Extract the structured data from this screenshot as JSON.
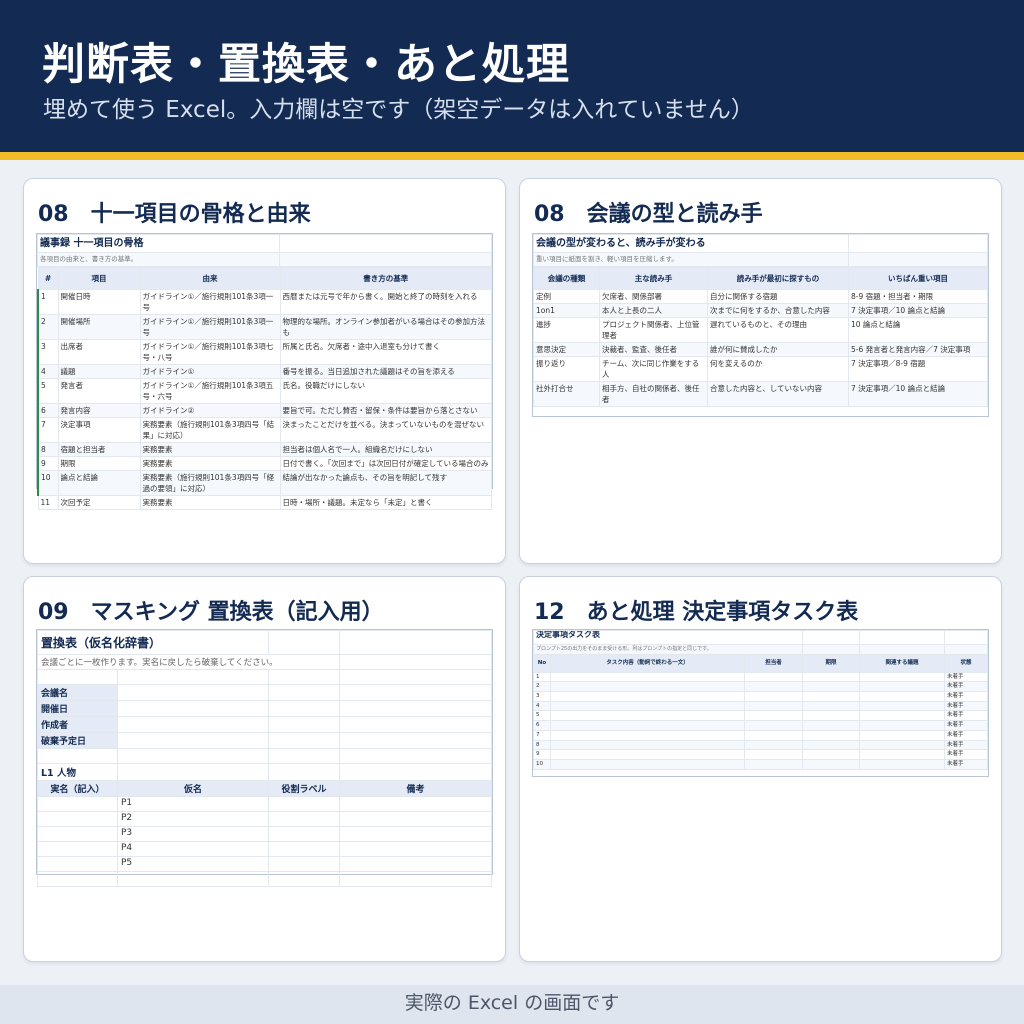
{
  "header": {
    "title": "判断表・置換表・あと処理",
    "subtitle": "埋めて使う Excel。入力欄は空です（架空データは入れていません）"
  },
  "panels": [
    {
      "title": "08　十一項目の骨格と由来",
      "sheet_title": "議事録 十一項目の骨格",
      "sheet_note": "各項目の由来と、書き方の基準。",
      "columns": [
        "#",
        "項目",
        "由来",
        "書き方の基準"
      ],
      "rows": [
        [
          "1",
          "開催日時",
          "ガイドライン①／施行規則101条3項一号",
          "西暦または元号で年から書く。開始と終了の時刻を入れる"
        ],
        [
          "2",
          "開催場所",
          "ガイドライン①／施行規則101条3項一号",
          "物理的な場所。オンライン参加者がいる場合はその参加方法も"
        ],
        [
          "3",
          "出席者",
          "ガイドライン①／施行規則101条3項七号・八号",
          "所属と氏名。欠席者・途中入退室も分けて書く"
        ],
        [
          "4",
          "議題",
          "ガイドライン①",
          "番号を振る。当日追加された議題はその旨を添える"
        ],
        [
          "5",
          "発言者",
          "ガイドライン①／施行規則101条3項五号・六号",
          "氏名。役職だけにしない"
        ],
        [
          "6",
          "発言内容",
          "ガイドライン②",
          "要旨で可。ただし賛否・留保・条件は要旨から落とさない"
        ],
        [
          "7",
          "決定事項",
          "実務要素（施行規則101条3項四号「結果」に対応）",
          "決まったことだけを並べる。決まっていないものを混ぜない"
        ],
        [
          "8",
          "宿題と担当者",
          "実務要素",
          "担当者は個人名で一人。組織名だけにしない"
        ],
        [
          "9",
          "期限",
          "実務要素",
          "日付で書く。「次回まで」は次回日付が確定している場合のみ"
        ],
        [
          "10",
          "論点と結論",
          "実務要素（施行規則101条3項四号「経過の要領」に対応）",
          "結論が出なかった論点も、その旨を明記して残す"
        ],
        [
          "11",
          "次回予定",
          "実務要素",
          "日時・場所・議題。未定なら「未定」と書く"
        ]
      ]
    },
    {
      "title": "08　会議の型と読み手",
      "sheet_title": "会議の型が変わると、読み手が変わる",
      "sheet_note": "重い項目に紙面を割き、軽い項目を圧縮します。",
      "columns": [
        "会議の種類",
        "主な読み手",
        "読み手が最初に探すもの",
        "いちばん重い項目"
      ],
      "rows": [
        [
          "定例",
          "欠席者、関係部署",
          "自分に関係する宿題",
          "8-9 宿題・担当者・期限"
        ],
        [
          "1on1",
          "本人と上長の二人",
          "次までに何をするか、合意した内容",
          "7 決定事項／10 論点と結論"
        ],
        [
          "進捗",
          "プロジェクト関係者、上位管理者",
          "遅れているものと、その理由",
          "10 論点と結論"
        ],
        [
          "意思決定",
          "決裁者、監査、後任者",
          "誰が何に賛成したか",
          "5-6 発言者と発言内容／7 決定事項"
        ],
        [
          "振り返り",
          "チーム、次に同じ作業をする人",
          "何を変えるのか",
          "7 決定事項／8-9 宿題"
        ],
        [
          "社外打合せ",
          "相手方、自社の関係者、後任者",
          "合意した内容と、していない内容",
          "7 決定事項／10 論点と結論"
        ]
      ]
    },
    {
      "title": "09　マスキング 置換表（記入用）",
      "sheet_title": "置換表（仮名化辞書）",
      "sheet_note": "会議ごとに一枚作ります。実名に戻したら破棄してください。",
      "fields": [
        "会議名",
        "開催日",
        "作成者",
        "破棄予定日"
      ],
      "section": "L1 人物",
      "columns": [
        "実名（記入）",
        "仮名",
        "役割ラベル",
        "備考"
      ],
      "aliases": [
        "P1",
        "P2",
        "P3",
        "P4",
        "P5"
      ]
    },
    {
      "title": "12　あと処理 決定事項タスク表",
      "sheet_title": "決定事項タスク表",
      "sheet_note": "プロンプト25の出力をそのまま受ける形。列はプロンプトの指定と同じです。",
      "columns": [
        "No",
        "タスク内容（動詞で終わる一文）",
        "担当者",
        "期限",
        "関連する議題",
        "状態"
      ],
      "rows": [
        [
          "1",
          "未着手"
        ],
        [
          "2",
          "未着手"
        ],
        [
          "3",
          "未着手"
        ],
        [
          "4",
          "未着手"
        ],
        [
          "5",
          "未着手"
        ],
        [
          "6",
          "未着手"
        ],
        [
          "7",
          "未着手"
        ],
        [
          "8",
          "未着手"
        ],
        [
          "9",
          "未着手"
        ],
        [
          "10",
          "未着手"
        ]
      ]
    }
  ],
  "footer": "実際の Excel の画面です",
  "colors": {
    "header_bg": "#132a52",
    "accent": "#f2bd26",
    "table_head": "#e4ebf6"
  }
}
